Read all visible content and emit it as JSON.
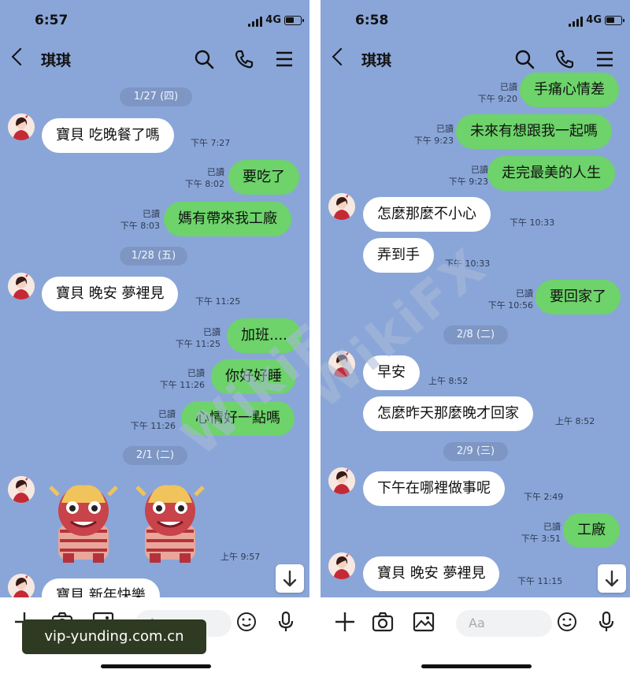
{
  "watermark": "WikiFX",
  "overlay": {
    "domain": "vip-yunding.com.cn"
  },
  "colors": {
    "chat_bg": "#8aa6d8",
    "out_bubble": "#6dd36a",
    "in_bubble": "#ffffff"
  },
  "panels": [
    {
      "status": {
        "time": "6:57",
        "network": "4G"
      },
      "header": {
        "title": "琪琪",
        "icons": [
          "back-icon",
          "search-icon",
          "phone-icon",
          "menu-icon"
        ]
      },
      "dates": [
        "1/27 (四)",
        "1/28 (五)",
        "2/1 (二)"
      ],
      "messages": [
        {
          "text": "寶貝 吃晚餐了嗎",
          "time": "下午 7:27"
        },
        {
          "text": "要吃了",
          "read": "已讀",
          "time": "下午 8:02"
        },
        {
          "text": "媽有帶來我工廠",
          "read": "已讀",
          "time": "下午 8:03"
        },
        {
          "text": "寶貝 晚安 夢裡見",
          "time": "下午 11:25"
        },
        {
          "text": "加班....",
          "read": "已讀",
          "time": "下午 11:25"
        },
        {
          "text": "你好好睡",
          "read": "已讀",
          "time": "下午 11:26"
        },
        {
          "text": "心情好一點嗎",
          "read": "已讀",
          "time": "下午 11:26"
        },
        {
          "sticker": "lion-dance-sticker",
          "time": "上午 9:57"
        },
        {
          "text": "寶貝 新年快樂"
        }
      ],
      "input_placeholder": "Aa"
    },
    {
      "status": {
        "time": "6:58",
        "network": "4G"
      },
      "header": {
        "title": "琪琪",
        "icons": [
          "back-icon",
          "search-icon",
          "phone-icon",
          "menu-icon"
        ]
      },
      "dates": [
        "2/8 (二)",
        "2/9 (三)"
      ],
      "messages": [
        {
          "text": "手痛心情差",
          "read": "已讀",
          "time": "下午 9:20"
        },
        {
          "text": "未來有想跟我一起嗎",
          "read": "已讀",
          "time": "下午 9:23"
        },
        {
          "text": "走完最美的人生",
          "read": "已讀",
          "time": "下午 9:23"
        },
        {
          "text": "怎麼那麼不小心",
          "time": "下午 10:33"
        },
        {
          "text": "弄到手",
          "time": "下午 10:33"
        },
        {
          "text": "要回家了",
          "read": "已讀",
          "time": "下午 10:56"
        },
        {
          "text": "早安",
          "time": "上午 8:52"
        },
        {
          "text": "怎麼昨天那麼晚才回家",
          "time": "上午 8:52"
        },
        {
          "text": "下午在哪裡做事呢",
          "time": "下午 2:49"
        },
        {
          "text": "工廠",
          "read": "已讀",
          "time": "下午 3:51"
        },
        {
          "text": "寶貝 晚安 夢裡見",
          "time": "下午 11:15"
        }
      ],
      "input_placeholder": "Aa"
    }
  ]
}
